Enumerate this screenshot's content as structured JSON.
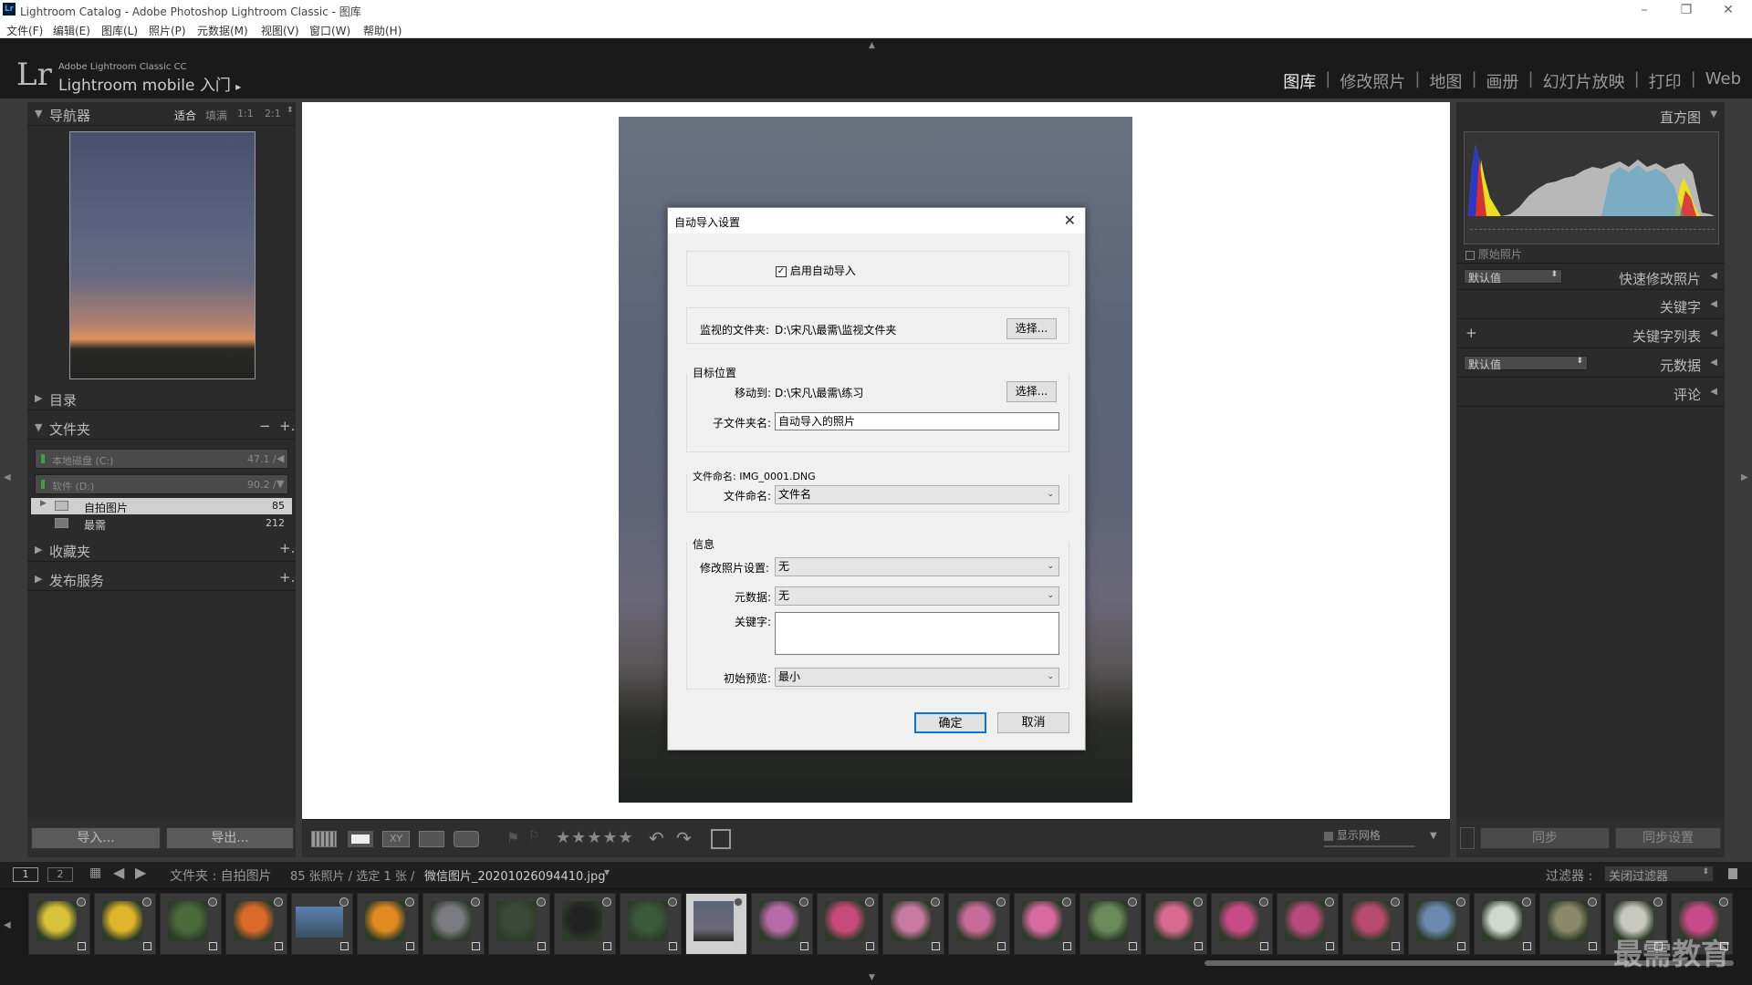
{
  "window": {
    "title": "Lightroom Catalog - Adobe Photoshop Lightroom Classic - 图库",
    "app_icon": "Lr"
  },
  "menu": [
    "文件(F)",
    "编辑(E)",
    "图库(L)",
    "照片(P)",
    "元数据(M)",
    "视图(V)",
    "窗口(W)",
    "帮助(H)"
  ],
  "identity": {
    "logo": "Lr",
    "line1": "Adobe Lightroom Classic CC",
    "line2": "Lightroom mobile 入门",
    "arrow": "▸"
  },
  "modules": [
    "图库",
    "修改照片",
    "地图",
    "画册",
    "幻灯片放映",
    "打印",
    "Web"
  ],
  "modules_sep": "|",
  "navigator": {
    "title": "导航器",
    "zoom": [
      "适合",
      "填满",
      "1:1",
      "2:1"
    ]
  },
  "left_panels": {
    "catalog": "目录",
    "folders": "文件夹",
    "folders_actions": [
      "−",
      "+."
    ],
    "collections": "收藏夹",
    "publish": "发布服务",
    "add": "+."
  },
  "volumes": [
    {
      "name": "本地磁盘 (C:)",
      "size": "47.1 / "
    },
    {
      "name": "软件 (D:)",
      "size": "90.2 / "
    }
  ],
  "folders": [
    {
      "name": "自拍图片",
      "count": "85"
    },
    {
      "name": "最需",
      "count": "212"
    }
  ],
  "left_buttons": {
    "import": "导入...",
    "export": "导出..."
  },
  "right_panels": {
    "histogram": "直方图",
    "original": "原始照片",
    "quick": "快速修改照片",
    "keywords": "关键字",
    "keyword_list": "关键字列表",
    "metadata": "元数据",
    "comments": "评论",
    "preset_default": "默认值",
    "plus": "+"
  },
  "right_buttons": {
    "sync": "同步",
    "sync_settings": "同步设置"
  },
  "dialog": {
    "title": "自动导入设置",
    "enable": "启用自动导入",
    "watched_label": "监视的文件夹:",
    "watched_value": "D:\\宋凡\\最需\\监视文件夹",
    "choose": "选择...",
    "dest_group": "目标位置",
    "move_label": "移动到:",
    "move_value": "D:\\宋凡\\最需\\练习",
    "subfolder_label": "子文件夹名:",
    "subfolder_value": "自动导入的照片",
    "naming_group": "文件命名: IMG_0001.DNG",
    "naming_label": "文件命名:",
    "naming_value": "文件名",
    "info_group": "信息",
    "develop_label": "修改照片设置:",
    "develop_value": "无",
    "metadata_label": "元数据:",
    "metadata_value": "无",
    "keywords_label": "关键字:",
    "keywords_value": "",
    "preview_label": "初始预览:",
    "preview_value": "最小",
    "ok": "确定",
    "cancel": "取消"
  },
  "toolbar": {
    "stars": "★★★★★",
    "show_grid": "显示网格"
  },
  "filmstrip_bar": {
    "page1": "1",
    "page2": "2",
    "source": "文件夹 : 自拍图片",
    "count": "85 张照片 / 选定 1 张 /",
    "filename": "微信图片_20201026094410.jpg",
    "filter_label": "过滤器 :",
    "filter_value": "关闭过滤器"
  },
  "watermark": "最需教育",
  "thumb_colors": [
    "#d8c23a",
    "#e0b52a",
    "#4a6a3a",
    "#d96a2a",
    "#5a80b0",
    "#e08a20",
    "#7a7a80",
    "#3a4a3a",
    "#222",
    "#3a5a3a",
    "#4a4c58",
    "#b86aa8",
    "#c84a7a",
    "#c87aa0",
    "#c86a9a",
    "#d86aa0",
    "#6a8a5a",
    "#d86a90",
    "#c84a88",
    "#b84a7a",
    "#b84a70",
    "#6a8ab0",
    "#d0d8d0",
    "#8a8a6a",
    "#c8c8c0",
    "#c84a8a"
  ]
}
